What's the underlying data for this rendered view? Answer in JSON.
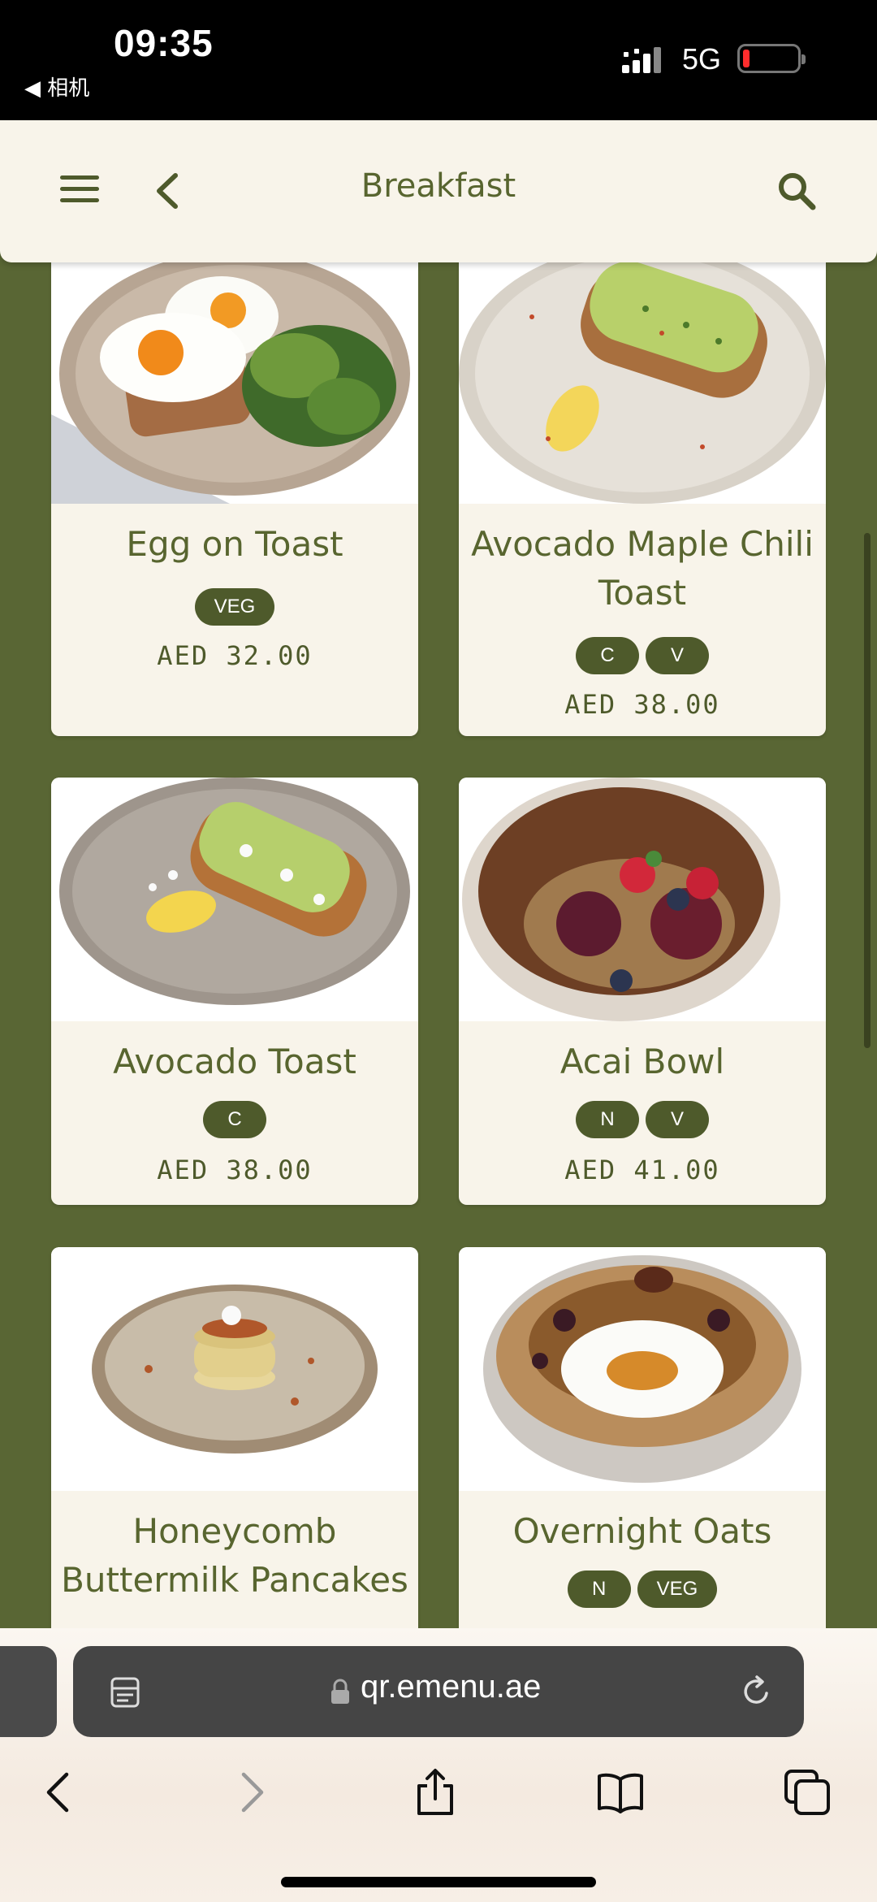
{
  "status": {
    "time": "09:35",
    "back_app": "◀ 相机",
    "network": "5G"
  },
  "header": {
    "title": "Breakfast"
  },
  "items": [
    {
      "name": "Egg on Toast",
      "badges": [
        "VEG"
      ],
      "price": "AED 32.00"
    },
    {
      "name": "Avocado Maple Chili Toast",
      "badges": [
        "C",
        "V"
      ],
      "price": "AED 38.00"
    },
    {
      "name": "Avocado Toast",
      "badges": [
        "C"
      ],
      "price": "AED 38.00"
    },
    {
      "name": "Acai Bowl",
      "badges": [
        "N",
        "V"
      ],
      "price": "AED 41.00"
    },
    {
      "name": "Honeycomb Buttermilk Pancakes",
      "badges": [],
      "price": ""
    },
    {
      "name": "Overnight Oats",
      "badges": [
        "N",
        "VEG"
      ],
      "price": ""
    }
  ],
  "browser": {
    "url": "qr.emenu.ae"
  },
  "colors": {
    "background": "#596634",
    "accent": "#4e5a2b",
    "card": "#f8f4ea"
  }
}
